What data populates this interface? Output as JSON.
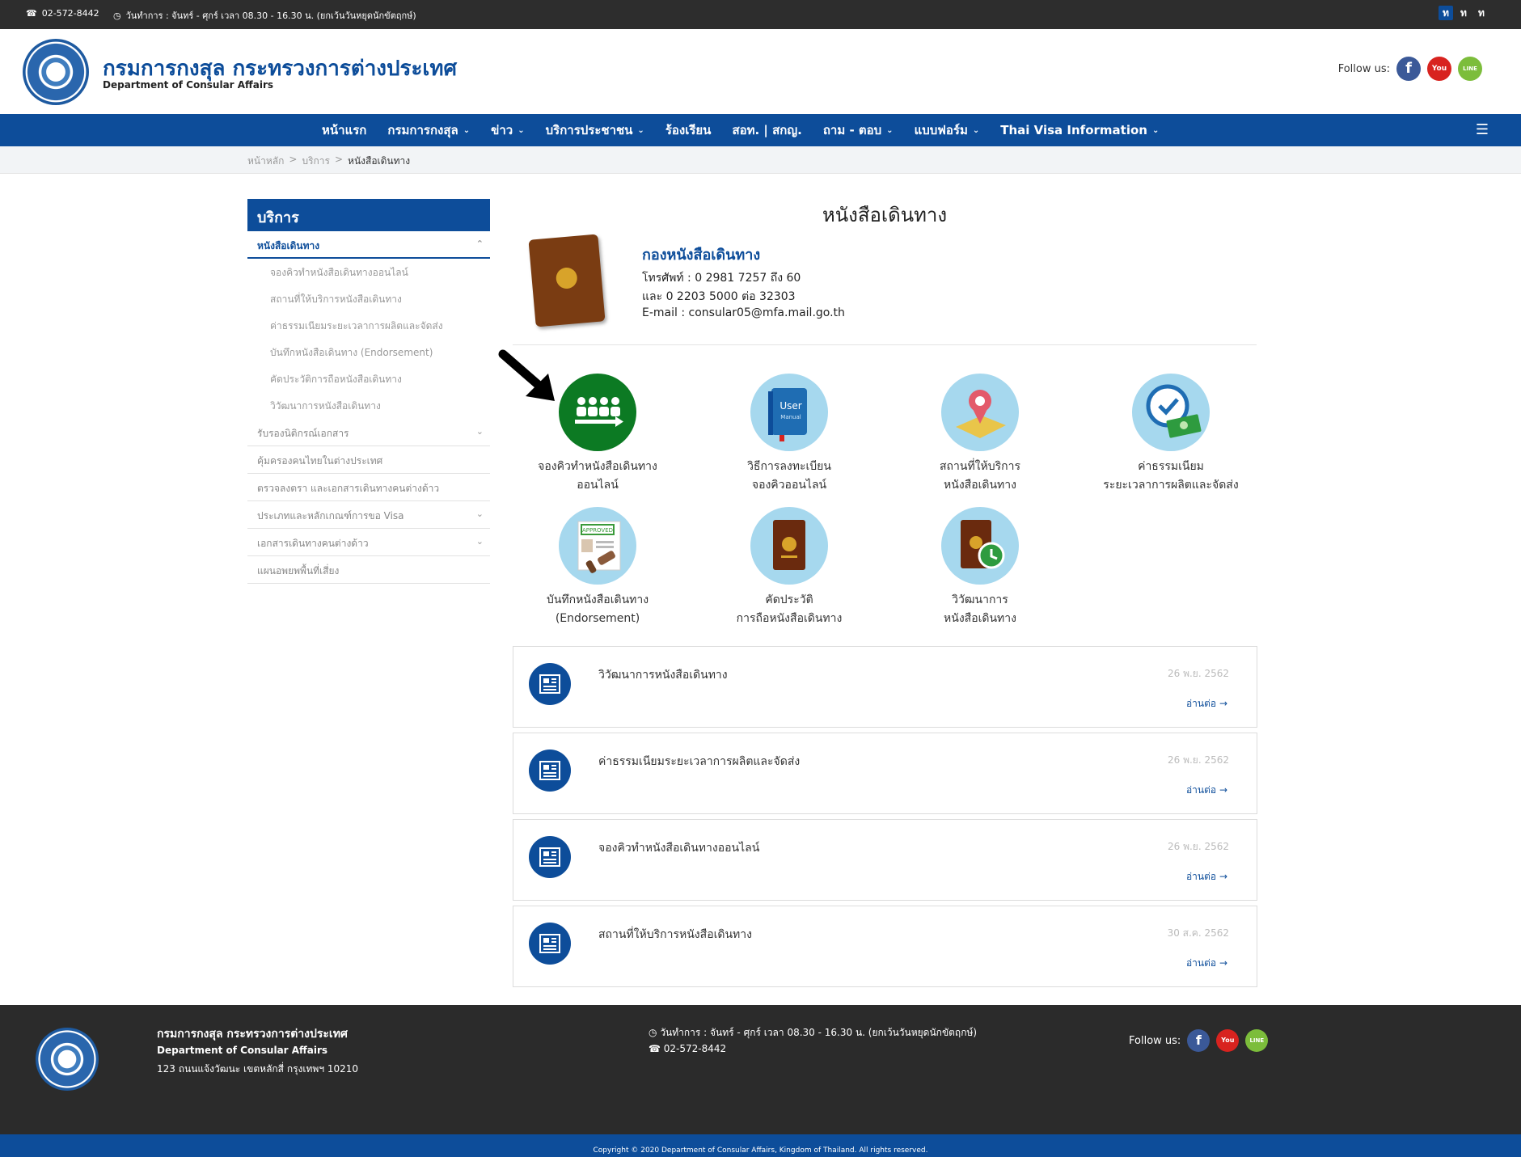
{
  "topbar": {
    "phone": "02-572-8442",
    "hours": "วันทำการ : จันทร์ - ศุกร์ เวลา 08.30 - 16.30 น. (ยกเว้นวันหยุดนักขัตฤกษ์)",
    "languages": [
      "ท",
      "ท",
      "ท"
    ]
  },
  "header": {
    "title": "กรมการกงสุล กระทรวงการต่างประเทศ",
    "subtitle": "Department of Consular Affairs",
    "follow_label": "Follow us:"
  },
  "nav": {
    "items": [
      {
        "label": "หน้าแรก",
        "dropdown": false
      },
      {
        "label": "กรมการกงสุล",
        "dropdown": true
      },
      {
        "label": "ข่าว",
        "dropdown": true
      },
      {
        "label": "บริการประชาชน",
        "dropdown": true
      },
      {
        "label": "ร้องเรียน",
        "dropdown": false
      },
      {
        "label": "สอท. | สกญ.",
        "dropdown": false
      },
      {
        "label": "ถาม - ตอบ",
        "dropdown": true
      },
      {
        "label": "แบบฟอร์ม",
        "dropdown": true
      },
      {
        "label": "Thai Visa Information",
        "dropdown": true
      }
    ]
  },
  "breadcrumb": {
    "home": "หน้าหลัก",
    "sep": ">",
    "section": "บริการ",
    "current": "หนังสือเดินทาง"
  },
  "sidebar": {
    "heading": "บริการ",
    "active": "หนังสือเดินทาง",
    "sub_items": [
      "จองคิวทำหนังสือเดินทางออนไลน์",
      "สถานที่ให้บริการหนังสือเดินทาง",
      "ค่าธรรมเนียมระยะเวลาการผลิตและจัดส่ง",
      "บันทึกหนังสือเดินทาง (Endorsement)",
      "คัดประวัติการถือหนังสือเดินทาง",
      "วิวัฒนาการหนังสือเดินทาง"
    ],
    "items": [
      {
        "label": "รับรองนิติกรณ์เอกสาร",
        "expandable": true
      },
      {
        "label": "คุ้มครองคนไทยในต่างประเทศ",
        "expandable": false
      },
      {
        "label": "ตรวจลงตรา และเอกสารเดินทางคนต่างด้าว",
        "expandable": false
      },
      {
        "label": "ประเภทและหลักเกณฑ์การขอ Visa",
        "expandable": true
      },
      {
        "label": "เอกสารเดินทางคนต่างด้าว",
        "expandable": true
      },
      {
        "label": "แผนอพยพพื้นที่เสี่ยง",
        "expandable": false
      }
    ]
  },
  "main": {
    "title": "หนังสือเดินทาง",
    "division": "กองหนังสือเดินทาง",
    "phone1": "โทรศัพท์ : 0 2981 7257 ถึง 60",
    "phone2": "และ 0 2203 5000 ต่อ 32303",
    "email": "E-mail : consular05@mfa.mail.go.th",
    "tiles": [
      {
        "line1": "จองคิวทำหนังสือเดินทาง",
        "line2": "ออนไลน์",
        "icon": "queue-people-icon"
      },
      {
        "line1": "วิธีการลงทะเบียน",
        "line2": "จองคิวออนไลน์",
        "icon": "user-manual-icon"
      },
      {
        "line1": "สถานที่ให้บริการ",
        "line2": "หนังสือเดินทาง",
        "icon": "location-pin-icon"
      },
      {
        "line1": "ค่าธรรมเนียม",
        "line2": "ระยะเวลาการผลิตและจัดส่ง",
        "icon": "fee-clock-money-icon"
      },
      {
        "line1": "บันทึกหนังสือเดินทาง",
        "line2": "(Endorsement)",
        "icon": "approved-stamp-icon"
      },
      {
        "line1": "คัดประวัติ",
        "line2": "การถือหนังสือเดินทาง",
        "icon": "passport-icon"
      },
      {
        "line1": "วิวัฒนาการ",
        "line2": "หนังสือเดินทาง",
        "icon": "passport-history-icon"
      }
    ],
    "stamp_text": "APPROVED",
    "manual_text": "User",
    "manual_sub": "Manual",
    "news": [
      {
        "title": "วิวัฒนาการหนังสือเดินทาง",
        "date": "26 พ.ย. 2562",
        "more": "อ่านต่อ"
      },
      {
        "title": "ค่าธรรมเนียมระยะเวลาการผลิตและจัดส่ง",
        "date": "26 พ.ย. 2562",
        "more": "อ่านต่อ"
      },
      {
        "title": "จองคิวทำหนังสือเดินทางออนไลน์",
        "date": "26 พ.ย. 2562",
        "more": "อ่านต่อ"
      },
      {
        "title": "สถานที่ให้บริการหนังสือเดินทาง",
        "date": "30 ส.ค. 2562",
        "more": "อ่านต่อ"
      }
    ]
  },
  "footer": {
    "title": "กรมการกงสุล กระทรวงการต่างประเทศ",
    "subtitle": "Department of Consular Affairs",
    "address": "123 ถนนแจ้งวัฒนะ เขตหลักสี่ กรุงเทพฯ 10210",
    "hours": "วันทำการ : จันทร์ - ศุกร์ เวลา 08.30 - 16.30 น. (ยกเว้นวันหยุดนักขัตฤกษ์)",
    "phone": "02-572-8442",
    "follow_label": "Follow us:",
    "copyright": "Copyright © 2020 Department of Consular Affairs, Kingdom of Thailand. All rights reserved."
  },
  "colors": {
    "brand_blue": "#0d4d9a",
    "topbar": "#2d2d2d",
    "footer": "#2b2b2b",
    "tile_bg": "#a6d8ee",
    "tile_green": "#0c7a23"
  },
  "social": {
    "fb": "f",
    "yt": "You",
    "line": "LINE"
  }
}
